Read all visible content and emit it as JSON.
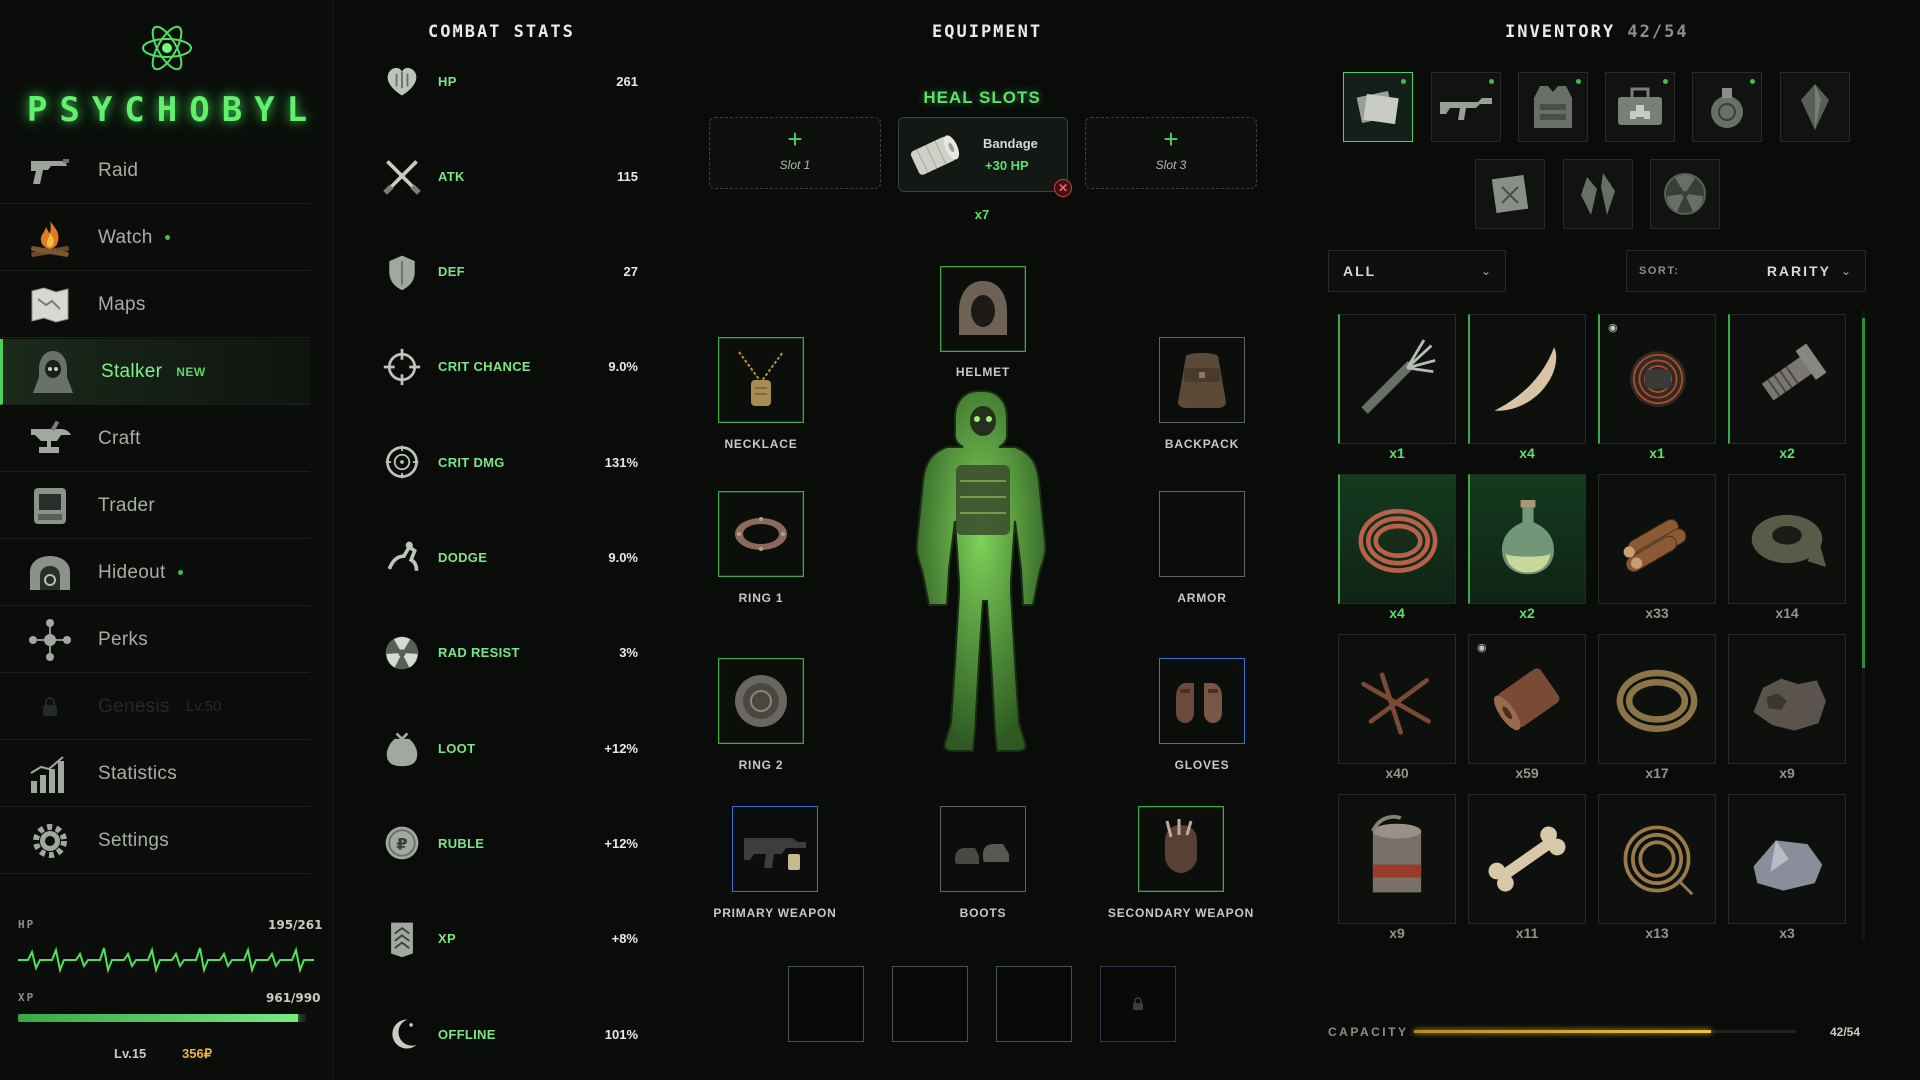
{
  "brand": {
    "name": "PSYCHOBYL"
  },
  "sidebar": {
    "items": [
      {
        "label": "Raid",
        "icon": "pistol-icon",
        "dot": false
      },
      {
        "label": "Watch",
        "icon": "campfire-icon",
        "dot": true
      },
      {
        "label": "Maps",
        "icon": "map-icon",
        "dot": false
      },
      {
        "label": "Stalker",
        "icon": "hooded-stalker-icon",
        "badge": "NEW",
        "active": true
      },
      {
        "label": "Craft",
        "icon": "anvil-icon",
        "dot": false
      },
      {
        "label": "Trader",
        "icon": "trader-booth-icon",
        "dot": false
      },
      {
        "label": "Hideout",
        "icon": "bunker-icon",
        "dot": true
      },
      {
        "label": "Perks",
        "icon": "perk-tree-icon",
        "dot": false
      },
      {
        "label": "Genesis",
        "icon": "lock-icon",
        "locked": true,
        "lock_text": "Lv.50"
      },
      {
        "label": "Statistics",
        "icon": "bar-chart-icon",
        "dot": false
      },
      {
        "label": "Settings",
        "icon": "gear-icon",
        "dot": false
      }
    ],
    "hp": {
      "label": "HP",
      "value": "195/261"
    },
    "xp": {
      "label": "XP",
      "value": "961/990",
      "fraction": 0.971
    },
    "level": "Lv.15",
    "rubles": "356₽"
  },
  "combat_stats": {
    "title": "COMBAT STATS",
    "items": [
      {
        "name": "HP",
        "value": "261",
        "icon": "heart-icon"
      },
      {
        "name": "ATK",
        "value": "115",
        "icon": "crossed-knives-icon"
      },
      {
        "name": "DEF",
        "value": "27",
        "icon": "shield-icon"
      },
      {
        "name": "CRIT CHANCE",
        "value": "9.0%",
        "icon": "crosshair-icon"
      },
      {
        "name": "CRIT DMG",
        "value": "131%",
        "icon": "target-icon"
      },
      {
        "name": "DODGE",
        "value": "9.0%",
        "icon": "dodge-icon"
      },
      {
        "name": "RAD RESIST",
        "value": "3%",
        "icon": "radiation-icon"
      },
      {
        "name": "LOOT",
        "value": "+12%",
        "icon": "loot-bag-icon"
      },
      {
        "name": "RUBLE",
        "value": "+12%",
        "icon": "ruble-coin-icon"
      },
      {
        "name": "XP",
        "value": "+8%",
        "icon": "chevron-rank-icon"
      },
      {
        "name": "OFFLINE",
        "value": "101%",
        "icon": "moon-icon"
      }
    ]
  },
  "equipment": {
    "title": "EQUIPMENT",
    "heal_title": "HEAL SLOTS",
    "heal_slots": [
      {
        "label": "Slot 1"
      },
      {
        "item": "Bandage",
        "effect": "+30 HP",
        "count": "x7"
      },
      {
        "label": "Slot 3"
      }
    ],
    "slots": {
      "helmet": "HELMET",
      "necklace": "NECKLACE",
      "backpack": "BACKPACK",
      "ring1": "RING 1",
      "armor": "ARMOR",
      "ring2": "RING 2",
      "gloves": "GLOVES",
      "primary": "PRIMARY WEAPON",
      "boots": "BOOTS",
      "secondary": "SECONDARY WEAPON"
    }
  },
  "inventory": {
    "title": "INVENTORY",
    "count": "42/54",
    "categories": [
      {
        "icon": "documents-icon",
        "active": true,
        "dot": true
      },
      {
        "icon": "rifle-icon",
        "dot": true
      },
      {
        "icon": "vest-icon",
        "dot": true
      },
      {
        "icon": "medkit-icon",
        "dot": true
      },
      {
        "icon": "grenade-icon",
        "dot": true
      },
      {
        "icon": "crystal-icon",
        "dot": false
      },
      {
        "icon": "blueprint-icon",
        "dot": false
      },
      {
        "icon": "artifact-icon",
        "dot": false
      },
      {
        "icon": "radiation-badge-icon",
        "dot": false
      }
    ],
    "filter": "ALL",
    "sort_label": "SORT:",
    "sort_value": "RARITY",
    "items": [
      {
        "icon": "multitool-icon",
        "qty": "x1",
        "rarity": "green"
      },
      {
        "icon": "tusk-icon",
        "qty": "x4",
        "rarity": "green"
      },
      {
        "icon": "wire-bundle-icon",
        "qty": "x1",
        "rarity": "green",
        "seen": true
      },
      {
        "icon": "bolt-icon",
        "qty": "x2",
        "rarity": "green"
      },
      {
        "icon": "copper-wire-icon",
        "qty": "x4",
        "rarity": "green-glow"
      },
      {
        "icon": "flask-icon",
        "qty": "x2",
        "rarity": "green-glow"
      },
      {
        "icon": "firewood-icon",
        "qty": "x33",
        "rarity": "common"
      },
      {
        "icon": "tape-icon",
        "qty": "x14",
        "rarity": "common"
      },
      {
        "icon": "nails-icon",
        "qty": "x40",
        "rarity": "common"
      },
      {
        "icon": "leather-roll-icon",
        "qty": "x59",
        "rarity": "common",
        "seen": true
      },
      {
        "icon": "rope-icon",
        "qty": "x17",
        "rarity": "common"
      },
      {
        "icon": "scrap-ore-icon",
        "qty": "x9",
        "rarity": "common"
      },
      {
        "icon": "tin-can-icon",
        "qty": "x9",
        "rarity": "common"
      },
      {
        "icon": "bone-icon",
        "qty": "x11",
        "rarity": "common"
      },
      {
        "icon": "twine-icon",
        "qty": "x13",
        "rarity": "common"
      },
      {
        "icon": "flint-icon",
        "qty": "x3",
        "rarity": "common"
      }
    ],
    "capacity": {
      "label": "CAPACITY",
      "value": "42/54",
      "fraction": 0.778
    }
  }
}
